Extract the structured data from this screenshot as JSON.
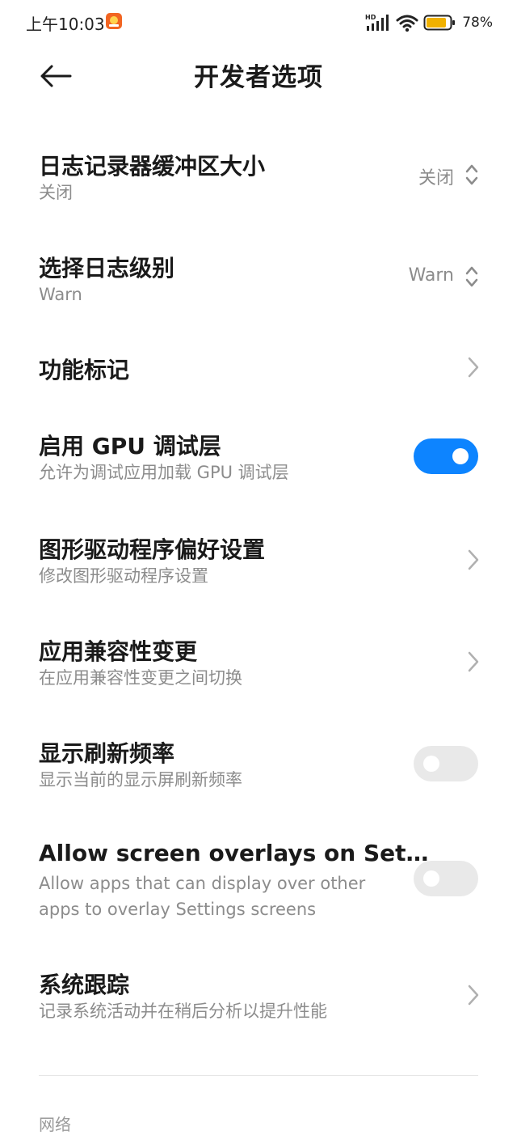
{
  "status_bar": {
    "time": "上午10:03",
    "battery": "78%",
    "network_label": "HD"
  },
  "header": {
    "title": "开发者选项"
  },
  "rows": [
    {
      "title": "日志记录器缓冲区大小",
      "subtitle": "关闭",
      "value": "关闭",
      "control": "updown"
    },
    {
      "title": "选择日志级别",
      "subtitle": "Warn",
      "value": "Warn",
      "control": "updown"
    },
    {
      "title": "功能标记",
      "control": "chevron"
    },
    {
      "title": "启用 GPU 调试层",
      "subtitle": "允许为调试应用加载 GPU 调试层",
      "control": "toggle",
      "on": true
    },
    {
      "title": "图形驱动程序偏好设置",
      "subtitle": "修改图形驱动程序设置",
      "control": "chevron"
    },
    {
      "title": "应用兼容性变更",
      "subtitle": "在应用兼容性变更之间切换",
      "control": "chevron"
    },
    {
      "title": "显示刷新频率",
      "subtitle": "显示当前的显示屏刷新频率",
      "control": "toggle",
      "on": false
    },
    {
      "title": "Allow screen overlays on Set…",
      "subtitle_line1": "Allow apps that can display over other",
      "subtitle_line2": "apps to overlay Settings screens",
      "control": "toggle",
      "on": false
    },
    {
      "title": "系统跟踪",
      "subtitle": "记录系统活动并在稍后分析以提升性能",
      "control": "chevron"
    }
  ],
  "next_section": {
    "label": "网络"
  },
  "colors": {
    "accent": "#0d84ff",
    "text_primary": "#1a1a1a",
    "text_secondary": "#8c8c8c",
    "toggle_off": "#e9e9e9"
  },
  "icons": [
    "back-arrow-icon",
    "app-notification-icon",
    "signal-icon",
    "wifi-icon",
    "battery-icon",
    "updown-icon",
    "chevron-right-icon"
  ]
}
